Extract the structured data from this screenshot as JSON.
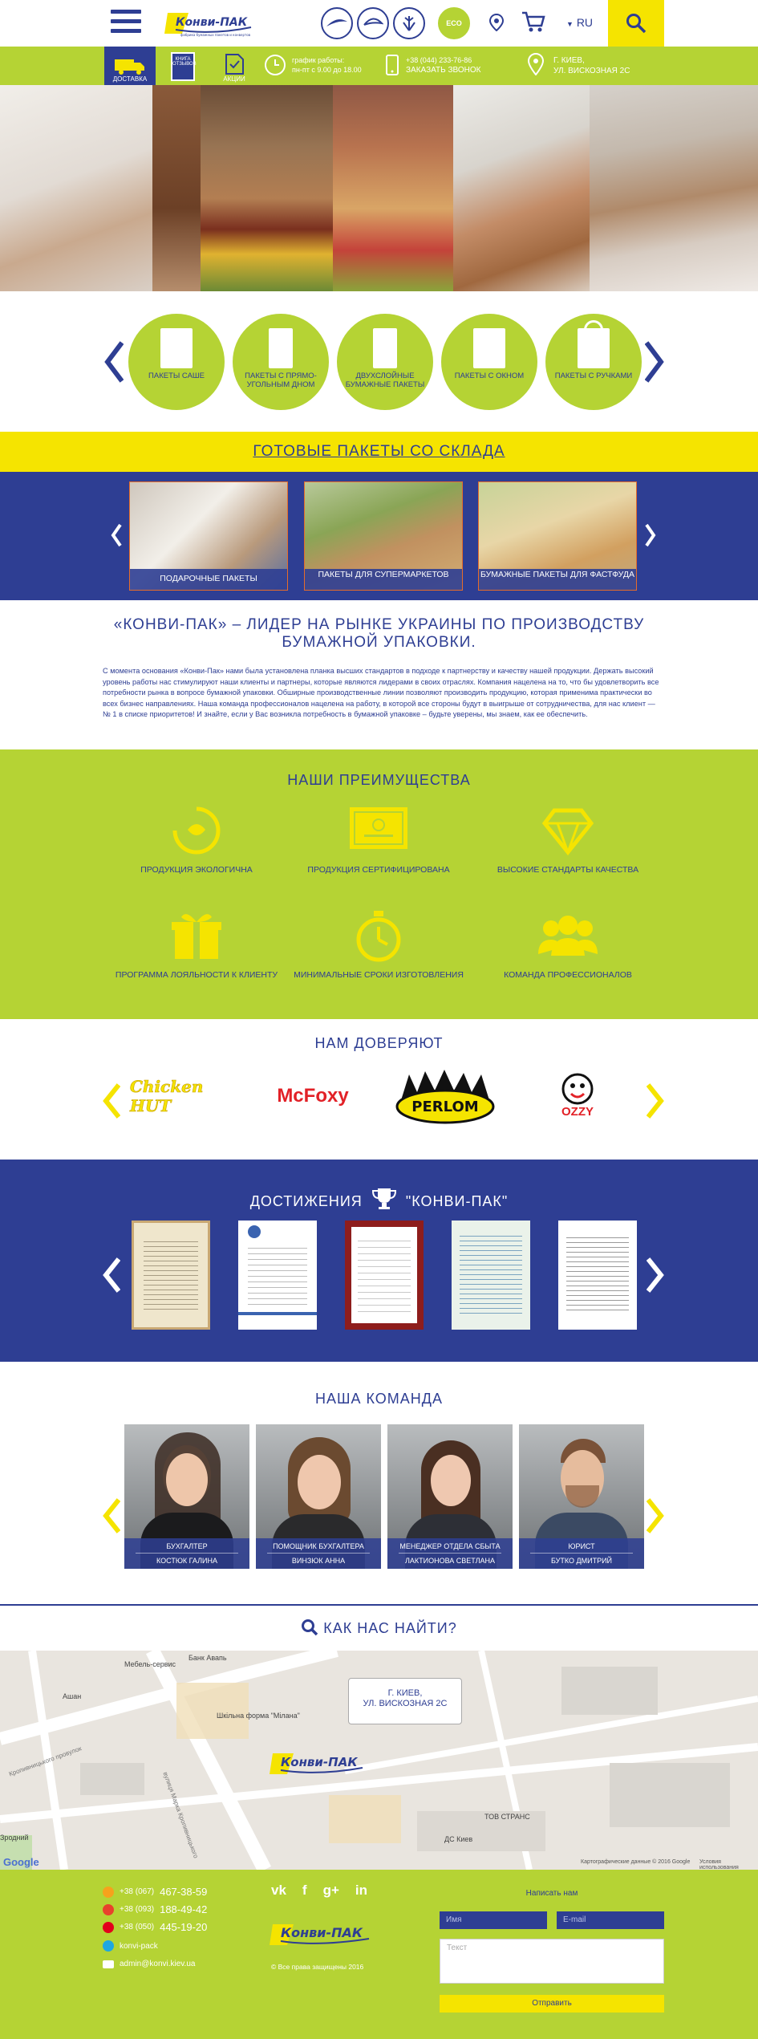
{
  "header": {
    "lang": "RU",
    "certs": [
      "UA",
      "ECO"
    ],
    "tiles": [
      "Доставка",
      "Книга отзывов",
      "Акции"
    ],
    "schedule_label": "график работы:",
    "schedule": "пн-пт с 9.00 до 18.00",
    "phone": "+38 (044) 233-76-86",
    "callback": "ЗАКАЗАТЬ ЗВОНОК",
    "city": "г. Киев,",
    "street": "ул. Вискозная 2с"
  },
  "categories": [
    "Пакеты саше",
    "Пакеты с прямо-угольным дном",
    "Двухслойные бумажные пакеты",
    "Пакеты с окном",
    "Пакеты с ручками"
  ],
  "ready": {
    "title": "ГОТОВЫЕ ПАКЕТЫ СО СКЛАДА",
    "products": [
      "Подарочные пакеты",
      "Пакеты для супермаркетов",
      "Бумажные пакеты для фастфуда"
    ]
  },
  "about": {
    "title": "«КОНВИ-ПАК» – ЛИДЕР НА РЫНКЕ УКРАИНЫ ПО ПРОИЗВОДСТВУ БУМАЖНОЙ УПАКОВКИ.",
    "text": "С момента основания «Конви-Пак» нами была установлена планка высших стандартов в подходе к партнерству и качеству нашей продукции. Держать высокий уровень работы нас стимулируют наши клиенты и партнеры, которые являются лидерами в своих отраслях. Компания нацелена на то, что бы удовлетворить все потребности рынка в вопросе бумажной упаковки. Обширные производственные линии позволяют производить продукцию, которая применима практически во всех бизнес направлениях. Наша команда профессионалов нацелена на работу, в которой все стороны будут в выигрыше от сотрудничества, для нас клиент — № 1 в списке приоритетов! И знайте, если у Вас возникла потребность в бумажной упаковке – будьте уверены, мы знаем, как ее обеспечить."
  },
  "advantages": {
    "title": "НАШИ ПРЕИМУЩЕСТВА",
    "items": [
      "Продукция экологична",
      "Продукция сертифицирована",
      "Высокие стандарты качества",
      "Программа лояльности к клиенту",
      "Минимальные сроки изготовления",
      "Команда профессионалов"
    ]
  },
  "clients": {
    "title": "НАМ ДОВЕРЯЮТ",
    "items": [
      "Chicken HUT",
      "McFoxy",
      "PERLOM",
      "OZZY"
    ]
  },
  "achievements": {
    "title": "ДОСТИЖЕНИЯ",
    "title2": "\"КОНВИ-ПАК\""
  },
  "team": {
    "title": "НАША КОМАНДА",
    "members": [
      {
        "role": "Бухгалтер",
        "name": "Костюк Галина"
      },
      {
        "role": "Помощник бухгалтера",
        "name": "Винзюк Анна"
      },
      {
        "role": "Менеджер отдела сбыта",
        "name": "Лактионова Светлана"
      },
      {
        "role": "Юрист",
        "name": "Бутко Дмитрий"
      }
    ]
  },
  "find": {
    "title": "КАК НАС НАЙТИ?"
  },
  "map": {
    "labels": [
      "Мебель-сервис",
      "Банк Авапь",
      "Ашан",
      "Шкільна форма \"Мілана\"",
      "ТОВ СТРАНС",
      "ДС Киев",
      "вулиця Марка Кропивницького",
      "Кропивницького провулок",
      "Зродний"
    ],
    "callout1": "г. Киев,",
    "callout2": "ул. Вискозная 2с",
    "copyright": "Картографические данные © 2016 Google",
    "terms": "Условия использования",
    "google": "Google"
  },
  "footer": {
    "phones": [
      {
        "code": "+38 (067)",
        "num": "467-38-59"
      },
      {
        "code": "+38 (093)",
        "num": "188-49-42"
      },
      {
        "code": "+38 (050)",
        "num": "445-19-20"
      }
    ],
    "skype": "konvi-pack",
    "email": "admin@konvi.kiev.ua",
    "social": [
      "vk",
      "f",
      "g+",
      "in"
    ],
    "rights": "© Все права защищены 2016",
    "form_title": "Написать нам",
    "name_ph": "Имя",
    "email_ph": "E-mail",
    "text_ph": "Текст",
    "submit": "Отправить"
  },
  "logo": {
    "text": "Конви-ПАК",
    "tagline": "фабрика бумажных пакетов и конвертов"
  },
  "colors": {
    "blue": "#2e3e93",
    "green": "#b5d334",
    "yellow": "#f5e400",
    "orange": "#e56c2b"
  }
}
